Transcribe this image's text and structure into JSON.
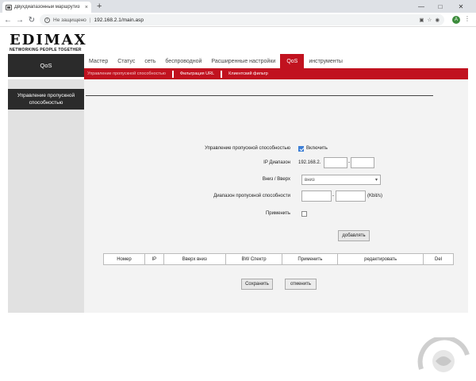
{
  "browser": {
    "tab_title": "Двухдиапазонный маршрутиз",
    "tab_close": "×",
    "new_tab": "+",
    "security_text": "Не защищено",
    "url": "192.168.2.1/main.asp",
    "profile_initial": "A"
  },
  "logo": {
    "brand": "EDIMAX",
    "tagline": "NETWORKING PEOPLE TOGETHER"
  },
  "nav": {
    "section": "QoS",
    "items": [
      "Мастер",
      "Статус",
      "сеть",
      "беспроводной",
      "Расширенные настройки",
      "QoS",
      "инструменты"
    ],
    "active_index": 5
  },
  "subnav": {
    "items": [
      "Управление пропускной способностью",
      "Фильтрация URL",
      "Клиентский фильтр"
    ],
    "current_index": 0
  },
  "left_panel": {
    "item": "Управление пропускной способностью"
  },
  "form": {
    "bw_label": "Управление пропускной способностью",
    "enable_label": "Включить",
    "enable_checked": true,
    "ip_label": "IP Диапазон",
    "ip_prefix": "192.168.2.",
    "ip_dash": "-",
    "dir_label": "Вниз / Вверх",
    "dir_value": "вниз",
    "range_label": "Диапазон пропускной способности",
    "range_dash": "-",
    "range_unit": "(Kbit/s)",
    "apply_label": "Применить",
    "apply_checked": false,
    "add_button": "добавлять"
  },
  "table": {
    "columns": [
      "Номер",
      "IP",
      "Вверх вниз",
      "BW Спектр",
      "Применить",
      "редактировать",
      "Del"
    ]
  },
  "actions": {
    "save": "Сохранить",
    "cancel": "отменить"
  },
  "colors": {
    "accent": "#c1121f",
    "dark": "#2b2b2b",
    "panel": "#e1e1e1"
  }
}
